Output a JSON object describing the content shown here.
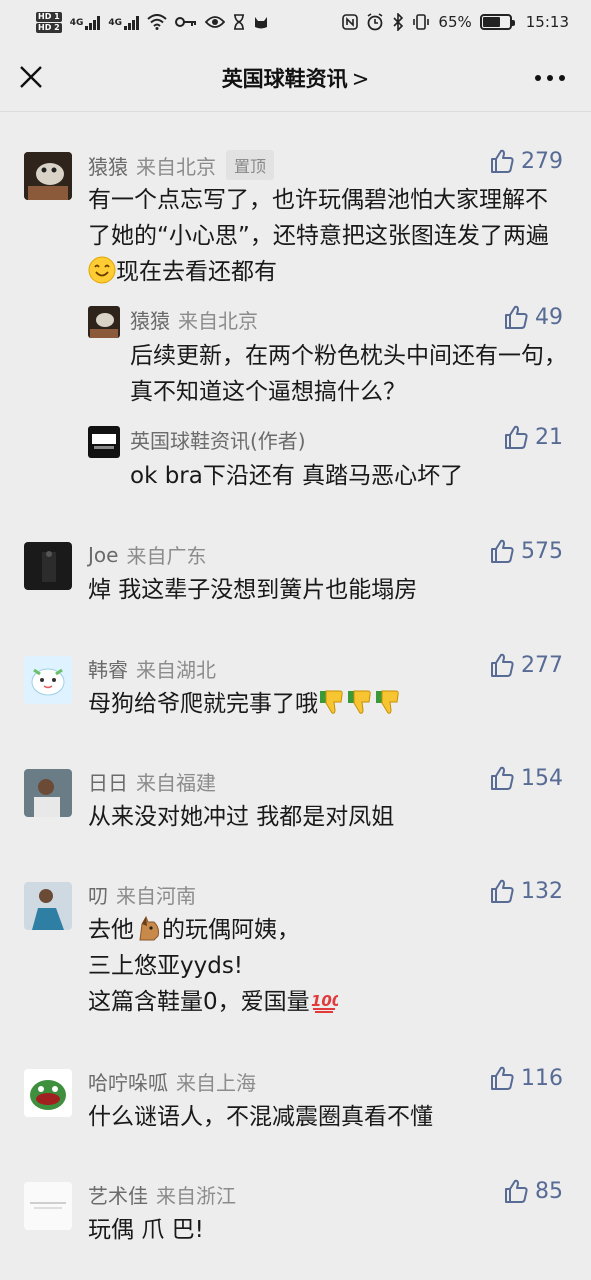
{
  "status_bar": {
    "hd1": "HD 1",
    "hd2": "HD 2",
    "net1": "4G",
    "net2": "4G",
    "battery_percent_label": "65%",
    "battery_level": 0.65,
    "time": "15:13"
  },
  "nav": {
    "title": "英国球鞋资讯",
    "chevron": ">"
  },
  "pinned_label": "置顶",
  "comments": [
    {
      "name": "猿猿",
      "location": "来自北京",
      "likes": "279",
      "text_part1": "有一个点忘写了，也许玩偶碧池怕大家理解不了她的“小心思”，还特意把这张图连发了两遍",
      "emoji": "smiling-face",
      "text_part2": "现在去看还都有",
      "replies": [
        {
          "name": "猿猿",
          "location": "来自北京",
          "likes": "49",
          "text": "后续更新，在两个粉色枕头中间还有一句，真不知道这个逼想搞什么？"
        },
        {
          "name": "英国球鞋资讯(作者)",
          "likes": "21",
          "text": "ok bra下沿还有 真踏马恶心坏了"
        }
      ]
    },
    {
      "name": "Joe",
      "location": "来自广东",
      "likes": "575",
      "text": "焯 我这辈子没想到簧片也能塌房"
    },
    {
      "name": "韩睿",
      "location": "来自湖北",
      "likes": "277",
      "text": "母狗给爷爬就完事了哦",
      "emoji": "thumbs-down x3"
    },
    {
      "name": "日日",
      "location": "来自福建",
      "likes": "154",
      "text": "从来没对她冲过 我都是对凤姐"
    },
    {
      "name": "叨",
      "location": "来自河南",
      "likes": "132",
      "text_line1_a": "去他",
      "emoji_horse": "horse-face",
      "text_line1_b": "的玩偶阿姨，",
      "text_line2": "三上悠亚yyds!",
      "text_line3": "这篇含鞋量0，爱国量",
      "emoji_100": "hundred-points"
    },
    {
      "name": "哈咛哚呱",
      "location": "来自上海",
      "likes": "116",
      "text": "什么谜语人，不混减震圈真看不懂"
    },
    {
      "name": "艺术佳",
      "location": "来自浙江",
      "likes": "85",
      "text": "玩偶 爪 巴!"
    }
  ],
  "colors": {
    "background": "#ededed",
    "like_blue": "#576b95",
    "name_gray": "#6b6b6b"
  }
}
